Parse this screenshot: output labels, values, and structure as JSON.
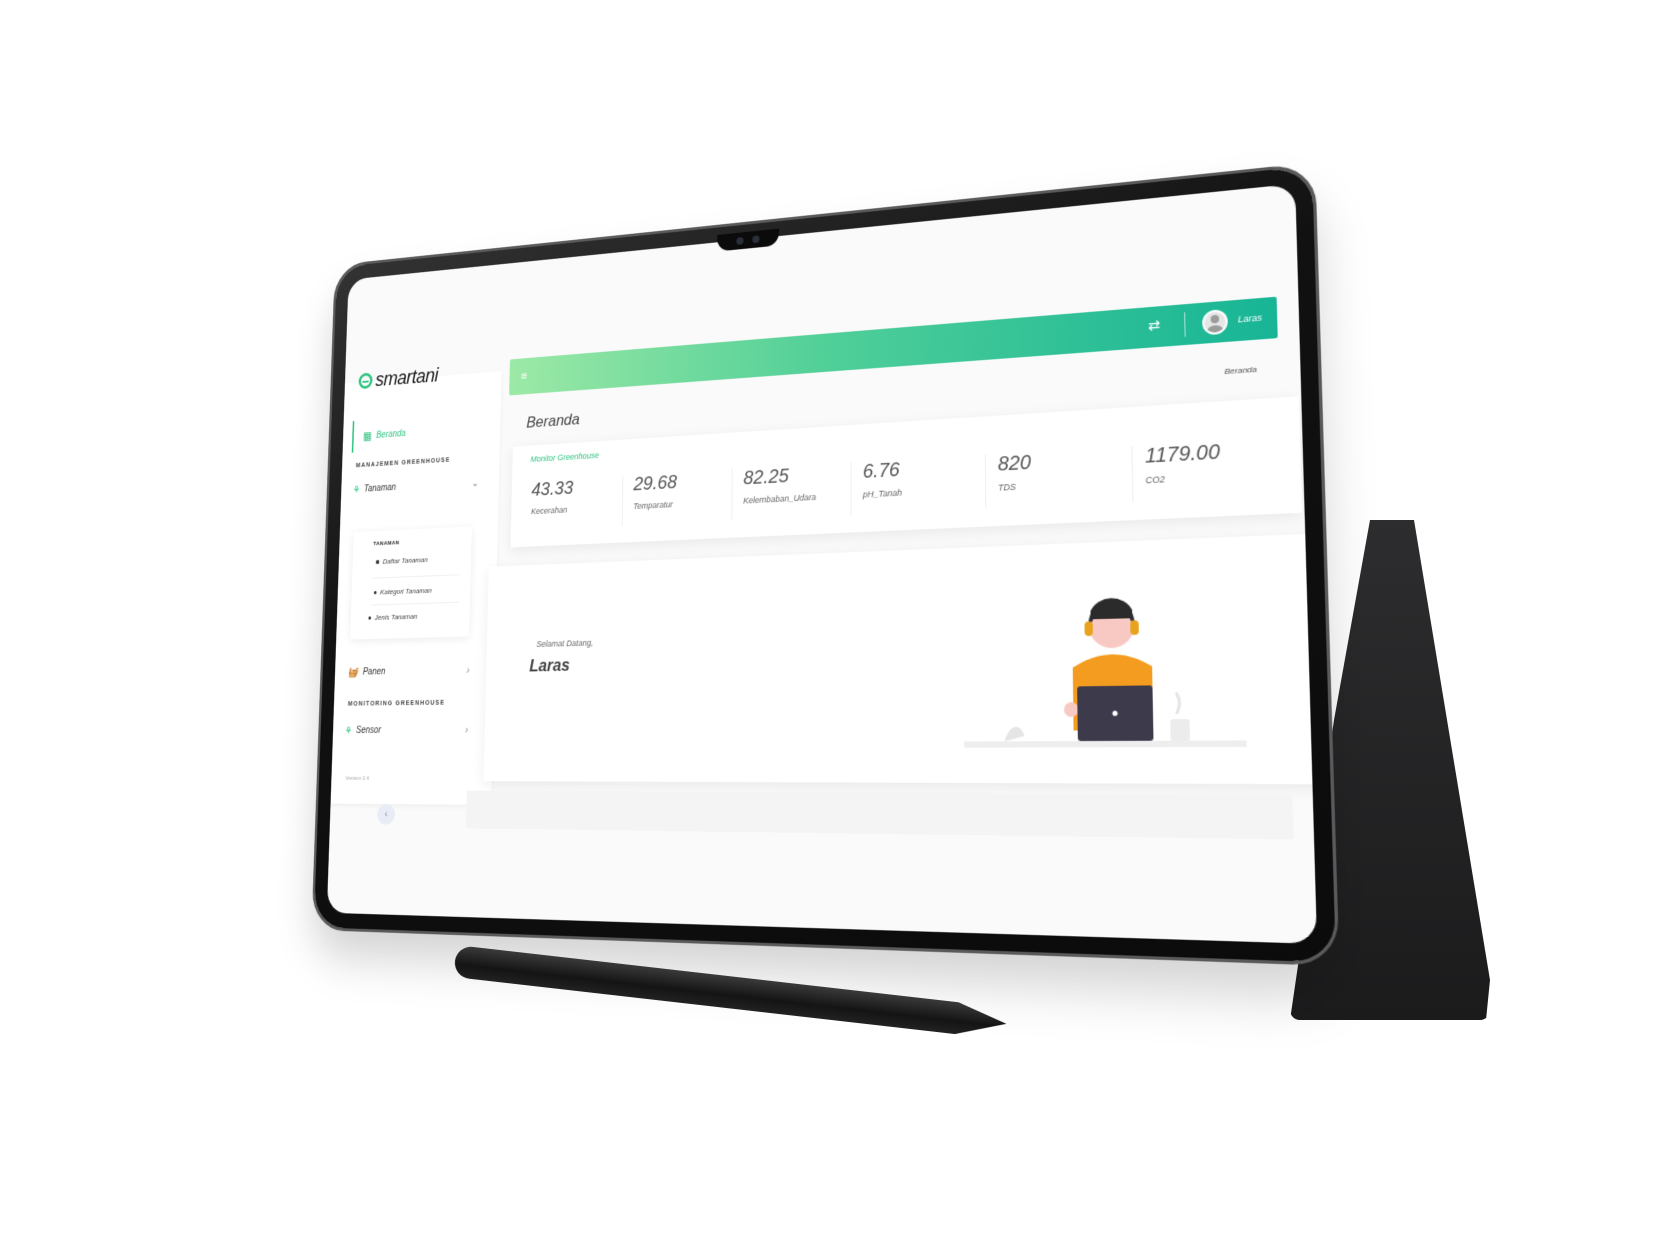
{
  "app": {
    "logo_text": "smartani",
    "brand_color": "#2fc480",
    "gradient_start": "#9de9a6",
    "gradient_end": "#17b596"
  },
  "sidebar": {
    "active_item": {
      "label": "Beranda",
      "icon": "dashboard-icon"
    },
    "section_management": "MANAJEMEN GREENHOUSE",
    "tanaman": {
      "label": "Tanaman",
      "icon": "plant-icon"
    },
    "submenu": {
      "heading": "TANAMAN",
      "items": [
        {
          "label": "Daftar Tanaman",
          "icon": "list-icon"
        },
        {
          "label": "Kategori Tanaman",
          "icon": "circle-icon"
        },
        {
          "label": "Jenis Tanaman",
          "icon": "circle-icon"
        }
      ]
    },
    "panen": {
      "label": "Panen",
      "icon": "basket-icon"
    },
    "section_monitoring": "MONITORING GREENHOUSE",
    "sensor": {
      "label": "Sensor",
      "icon": "plant-icon"
    },
    "version": "Version 2.4"
  },
  "topbar": {
    "menu_icon": "hamburger-icon",
    "swap_icon": "swap-icon",
    "user_name": "Laras"
  },
  "page": {
    "title": "Beranda",
    "breadcrumb": "Beranda"
  },
  "monitor": {
    "title": "Monitor Greenhouse",
    "metrics": [
      {
        "value": "43.33",
        "label": "Kecerahan"
      },
      {
        "value": "29.68",
        "label": "Temparatur"
      },
      {
        "value": "82.25",
        "label": "Kelembaban_Udara"
      },
      {
        "value": "6.76",
        "label": "pH_Tanah"
      },
      {
        "value": "820",
        "label": "TDS"
      },
      {
        "value": "1179.00",
        "label": "CO2"
      }
    ]
  },
  "welcome": {
    "greeting": "Selamat Datang,",
    "name": "Laras"
  }
}
